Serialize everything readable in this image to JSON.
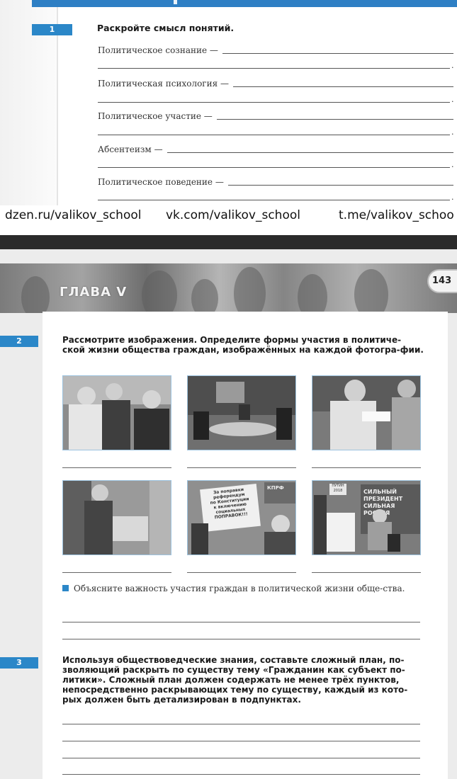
{
  "top": {
    "task_number": "1",
    "title": "Раскройте смысл понятий.",
    "terms": [
      {
        "label": "Политическое сознание —"
      },
      {
        "label": "Политическая психология —"
      },
      {
        "label": "Политическое участие —"
      },
      {
        "label": "Абсентеизм —"
      },
      {
        "label": "Политическое поведение —"
      }
    ],
    "line_end": "."
  },
  "watermarks": {
    "dzen": "dzen.ru/valikov_school",
    "vk": "vk.com/valikov_school",
    "tg": "t.me/valikov_schoo"
  },
  "bottom": {
    "chapter": "ГЛАВА V",
    "page_number": "143",
    "task2": {
      "number": "2",
      "title": "Рассмотрите изображения. Определите формы участия в политиче-ской жизни общества граждан, изображённых на каждой фотогра-фии.",
      "sub_task": "Объясните важность участия граждан в политической жизни обще-ства."
    },
    "task3": {
      "number": "3",
      "text": "Используя обществоведческие знания, составьте сложный план, по-зволяющий раскрыть по существу тему «Гражданин как субъект по-литики». Сложный план должен содержать не менее трёх пунктов, непосредственно раскрывающих тему по существу, каждый из кото-рых должен быть детализирован в подпунктах."
    },
    "photos": [
      {
        "signs": []
      },
      {
        "signs": []
      },
      {
        "signs": []
      },
      {
        "signs": []
      },
      {
        "signs": [
          "За поправки",
          "референдум",
          "по Конституции",
          "к включению",
          "социальных",
          "ПОПРАВОК!!!",
          "КПРФ"
        ]
      },
      {
        "signs": [
          "СИЛЬНЫЙ",
          "ПРЕЗИДЕНТ",
          "СИЛЬНАЯ",
          "РОССИЯ",
          "ПУТИН",
          "2018"
        ]
      }
    ]
  },
  "colors": {
    "accent_blue": "#2b87c8",
    "divider_dark": "#2b2b2b"
  }
}
